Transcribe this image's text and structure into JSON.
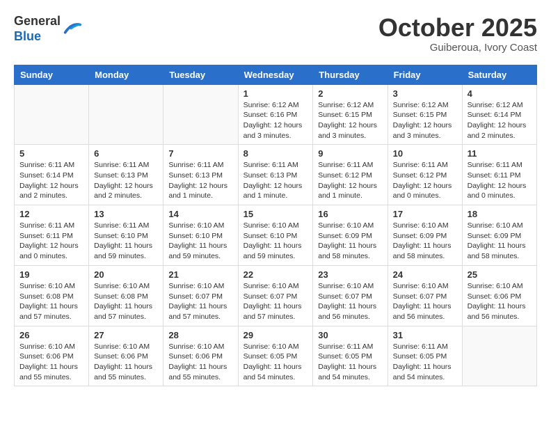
{
  "header": {
    "logo_line1": "General",
    "logo_line2": "Blue",
    "month": "October 2025",
    "location": "Guiberoua, Ivory Coast"
  },
  "weekdays": [
    "Sunday",
    "Monday",
    "Tuesday",
    "Wednesday",
    "Thursday",
    "Friday",
    "Saturday"
  ],
  "weeks": [
    [
      {
        "day": "",
        "info": ""
      },
      {
        "day": "",
        "info": ""
      },
      {
        "day": "",
        "info": ""
      },
      {
        "day": "1",
        "info": "Sunrise: 6:12 AM\nSunset: 6:16 PM\nDaylight: 12 hours\nand 3 minutes."
      },
      {
        "day": "2",
        "info": "Sunrise: 6:12 AM\nSunset: 6:15 PM\nDaylight: 12 hours\nand 3 minutes."
      },
      {
        "day": "3",
        "info": "Sunrise: 6:12 AM\nSunset: 6:15 PM\nDaylight: 12 hours\nand 3 minutes."
      },
      {
        "day": "4",
        "info": "Sunrise: 6:12 AM\nSunset: 6:14 PM\nDaylight: 12 hours\nand 2 minutes."
      }
    ],
    [
      {
        "day": "5",
        "info": "Sunrise: 6:11 AM\nSunset: 6:14 PM\nDaylight: 12 hours\nand 2 minutes."
      },
      {
        "day": "6",
        "info": "Sunrise: 6:11 AM\nSunset: 6:13 PM\nDaylight: 12 hours\nand 2 minutes."
      },
      {
        "day": "7",
        "info": "Sunrise: 6:11 AM\nSunset: 6:13 PM\nDaylight: 12 hours\nand 1 minute."
      },
      {
        "day": "8",
        "info": "Sunrise: 6:11 AM\nSunset: 6:13 PM\nDaylight: 12 hours\nand 1 minute."
      },
      {
        "day": "9",
        "info": "Sunrise: 6:11 AM\nSunset: 6:12 PM\nDaylight: 12 hours\nand 1 minute."
      },
      {
        "day": "10",
        "info": "Sunrise: 6:11 AM\nSunset: 6:12 PM\nDaylight: 12 hours\nand 0 minutes."
      },
      {
        "day": "11",
        "info": "Sunrise: 6:11 AM\nSunset: 6:11 PM\nDaylight: 12 hours\nand 0 minutes."
      }
    ],
    [
      {
        "day": "12",
        "info": "Sunrise: 6:11 AM\nSunset: 6:11 PM\nDaylight: 12 hours\nand 0 minutes."
      },
      {
        "day": "13",
        "info": "Sunrise: 6:11 AM\nSunset: 6:10 PM\nDaylight: 11 hours\nand 59 minutes."
      },
      {
        "day": "14",
        "info": "Sunrise: 6:10 AM\nSunset: 6:10 PM\nDaylight: 11 hours\nand 59 minutes."
      },
      {
        "day": "15",
        "info": "Sunrise: 6:10 AM\nSunset: 6:10 PM\nDaylight: 11 hours\nand 59 minutes."
      },
      {
        "day": "16",
        "info": "Sunrise: 6:10 AM\nSunset: 6:09 PM\nDaylight: 11 hours\nand 58 minutes."
      },
      {
        "day": "17",
        "info": "Sunrise: 6:10 AM\nSunset: 6:09 PM\nDaylight: 11 hours\nand 58 minutes."
      },
      {
        "day": "18",
        "info": "Sunrise: 6:10 AM\nSunset: 6:09 PM\nDaylight: 11 hours\nand 58 minutes."
      }
    ],
    [
      {
        "day": "19",
        "info": "Sunrise: 6:10 AM\nSunset: 6:08 PM\nDaylight: 11 hours\nand 57 minutes."
      },
      {
        "day": "20",
        "info": "Sunrise: 6:10 AM\nSunset: 6:08 PM\nDaylight: 11 hours\nand 57 minutes."
      },
      {
        "day": "21",
        "info": "Sunrise: 6:10 AM\nSunset: 6:07 PM\nDaylight: 11 hours\nand 57 minutes."
      },
      {
        "day": "22",
        "info": "Sunrise: 6:10 AM\nSunset: 6:07 PM\nDaylight: 11 hours\nand 57 minutes."
      },
      {
        "day": "23",
        "info": "Sunrise: 6:10 AM\nSunset: 6:07 PM\nDaylight: 11 hours\nand 56 minutes."
      },
      {
        "day": "24",
        "info": "Sunrise: 6:10 AM\nSunset: 6:07 PM\nDaylight: 11 hours\nand 56 minutes."
      },
      {
        "day": "25",
        "info": "Sunrise: 6:10 AM\nSunset: 6:06 PM\nDaylight: 11 hours\nand 56 minutes."
      }
    ],
    [
      {
        "day": "26",
        "info": "Sunrise: 6:10 AM\nSunset: 6:06 PM\nDaylight: 11 hours\nand 55 minutes."
      },
      {
        "day": "27",
        "info": "Sunrise: 6:10 AM\nSunset: 6:06 PM\nDaylight: 11 hours\nand 55 minutes."
      },
      {
        "day": "28",
        "info": "Sunrise: 6:10 AM\nSunset: 6:06 PM\nDaylight: 11 hours\nand 55 minutes."
      },
      {
        "day": "29",
        "info": "Sunrise: 6:10 AM\nSunset: 6:05 PM\nDaylight: 11 hours\nand 54 minutes."
      },
      {
        "day": "30",
        "info": "Sunrise: 6:11 AM\nSunset: 6:05 PM\nDaylight: 11 hours\nand 54 minutes."
      },
      {
        "day": "31",
        "info": "Sunrise: 6:11 AM\nSunset: 6:05 PM\nDaylight: 11 hours\nand 54 minutes."
      },
      {
        "day": "",
        "info": ""
      }
    ]
  ]
}
